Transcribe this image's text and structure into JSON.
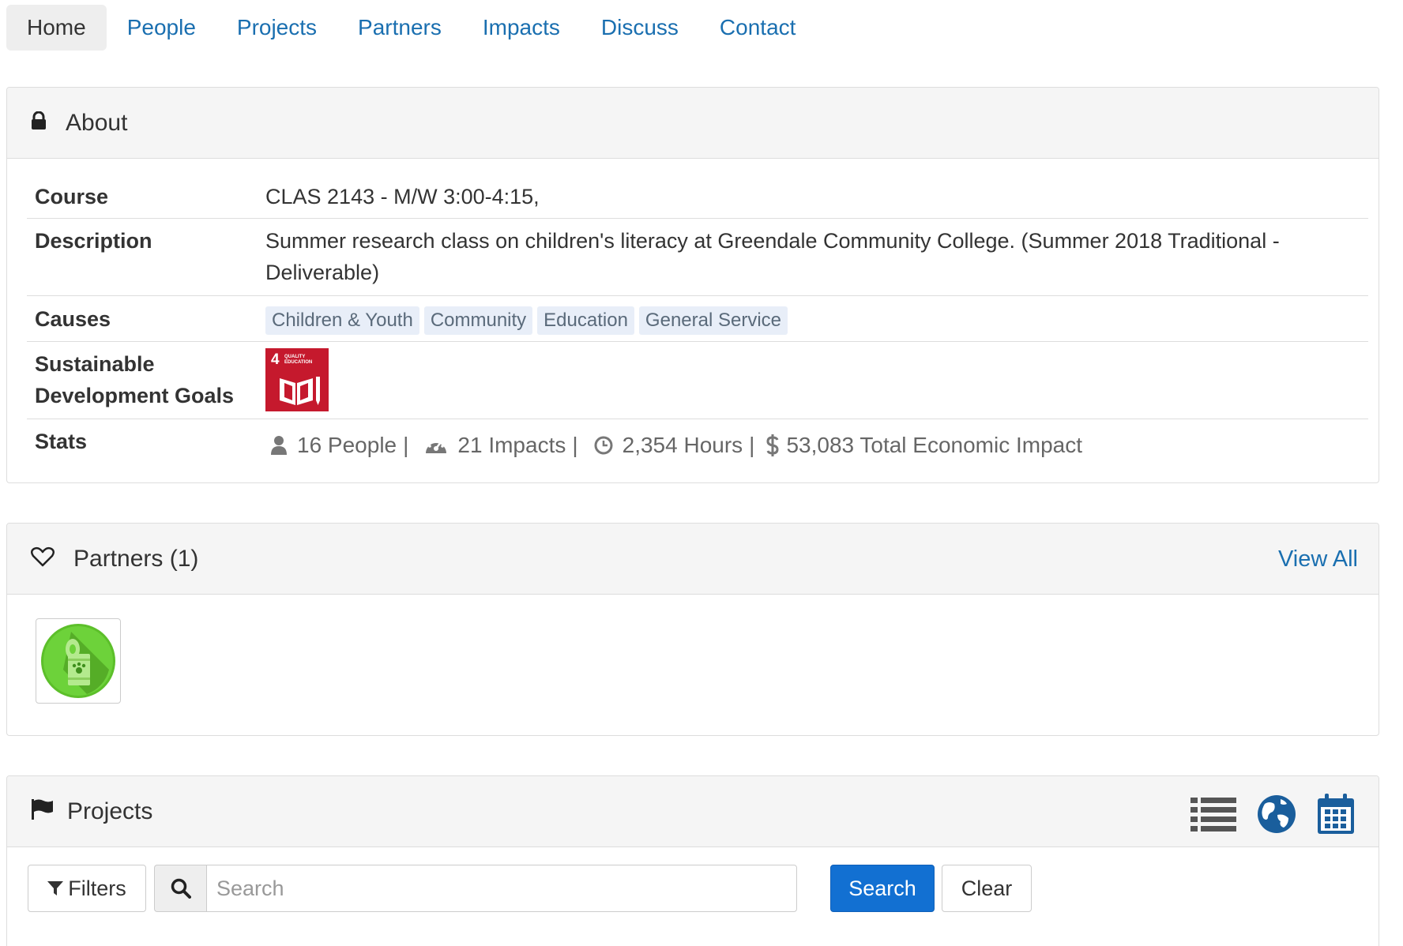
{
  "nav": {
    "items": [
      {
        "label": "Home",
        "active": true
      },
      {
        "label": "People"
      },
      {
        "label": "Projects"
      },
      {
        "label": "Partners"
      },
      {
        "label": "Impacts"
      },
      {
        "label": "Discuss"
      },
      {
        "label": "Contact"
      }
    ]
  },
  "about": {
    "title": "About",
    "icon": "lock-icon",
    "rows": {
      "course": {
        "label": "Course",
        "value": "CLAS 2143 - M/W 3:00-4:15,"
      },
      "description": {
        "label": "Description",
        "value": "Summer research class on children's literacy at Greendale Community College. (Summer 2018 Traditional - Deliverable)"
      },
      "causes": {
        "label": "Causes",
        "tags": [
          "Children & Youth",
          "Community",
          "Education",
          "General Service"
        ]
      },
      "sdg": {
        "label": "Sustainable Development Goals",
        "goal_number": "4",
        "goal_text": "QUALITY EDUCATION"
      },
      "stats": {
        "label": "Stats",
        "people": "16 People",
        "impacts": "21 Impacts",
        "hours": "2,354 Hours",
        "economic": "53,083 Total Economic Impact",
        "separator": "|"
      }
    }
  },
  "partners": {
    "title": "Partners (1)",
    "icon": "heart-icon",
    "view_all": "View All"
  },
  "projects": {
    "title": "Projects",
    "icon": "flag-icon",
    "view_icons": [
      "list-icon",
      "globe-icon",
      "calendar-icon"
    ],
    "filters_label": "Filters",
    "search_placeholder": "Search",
    "search_button": "Search",
    "clear_button": "Clear"
  },
  "colors": {
    "link": "#1a6fb0",
    "primary_button": "#1270d2",
    "sdg_red": "#c5192d",
    "tag_bg": "#e8eef8"
  }
}
